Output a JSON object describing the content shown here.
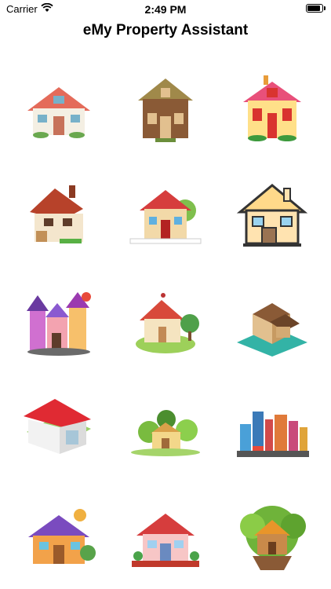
{
  "status_bar": {
    "carrier": "Carrier",
    "time": "2:49 PM",
    "wifi_icon": "wifi-icon",
    "battery_icon": "battery-icon"
  },
  "nav": {
    "title": "eMy Property Assistant"
  },
  "grid": {
    "items": [
      {
        "icon": "cottage-white-icon"
      },
      {
        "icon": "log-cabin-icon"
      },
      {
        "icon": "yellow-house-icon"
      },
      {
        "icon": "brick-cottage-icon"
      },
      {
        "icon": "picket-fence-house-icon"
      },
      {
        "icon": "outline-house-icon"
      },
      {
        "icon": "fairytale-castle-icon"
      },
      {
        "icon": "island-house-icon"
      },
      {
        "icon": "isometric-house-icon"
      },
      {
        "icon": "white-house-red-roof-icon"
      },
      {
        "icon": "village-house-icon"
      },
      {
        "icon": "city-skyline-icon"
      },
      {
        "icon": "purple-roof-house-icon"
      },
      {
        "icon": "pink-house-fence-icon"
      },
      {
        "icon": "treehouse-icon"
      }
    ]
  }
}
